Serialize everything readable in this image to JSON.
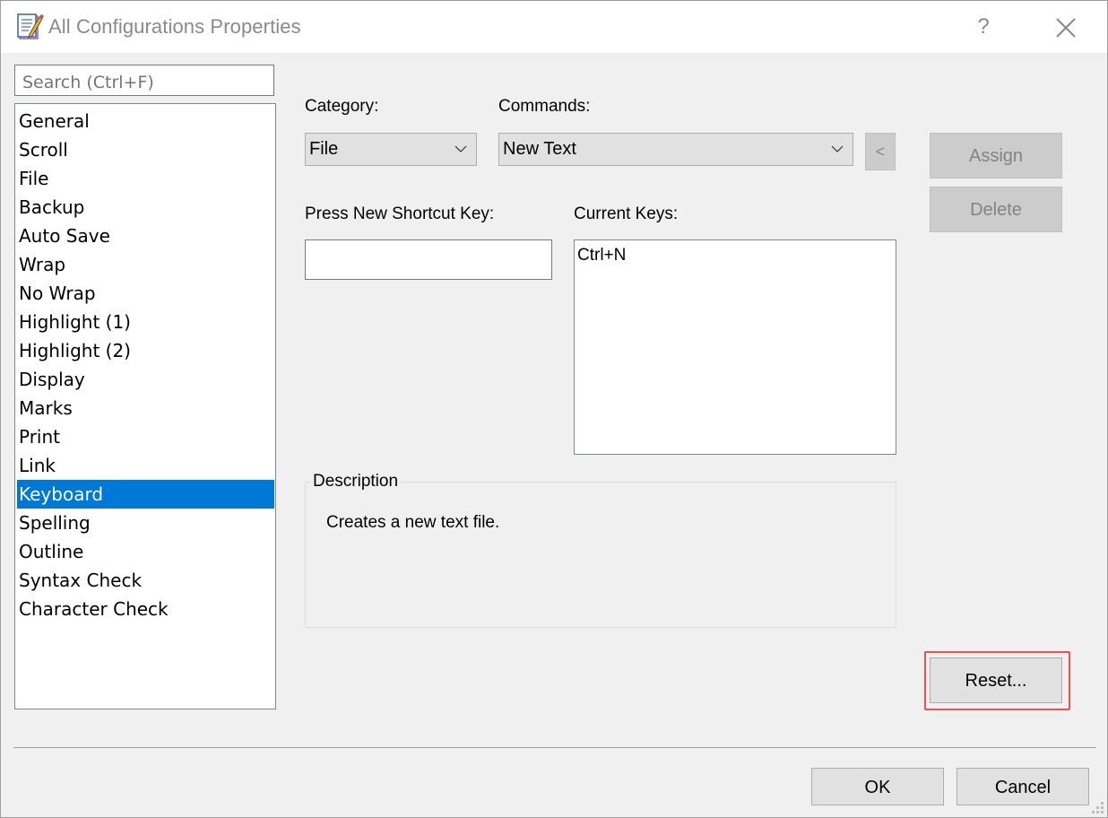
{
  "window": {
    "title": "All Configurations Properties",
    "help_label": "?",
    "icons": {
      "app": "notepad-pencil-icon",
      "help": "question-mark-icon",
      "close": "close-x-icon"
    }
  },
  "sidebar": {
    "search_placeholder": "Search (Ctrl+F)",
    "search_value": "",
    "selected": "Keyboard",
    "items": [
      {
        "label": "General"
      },
      {
        "label": "Scroll"
      },
      {
        "label": "File"
      },
      {
        "label": "Backup"
      },
      {
        "label": "Auto Save"
      },
      {
        "label": "Wrap"
      },
      {
        "label": "No Wrap"
      },
      {
        "label": "Highlight (1)"
      },
      {
        "label": "Highlight (2)"
      },
      {
        "label": "Display"
      },
      {
        "label": "Marks"
      },
      {
        "label": "Print"
      },
      {
        "label": "Link"
      },
      {
        "label": "Keyboard"
      },
      {
        "label": "Spelling"
      },
      {
        "label": "Outline"
      },
      {
        "label": "Syntax Check"
      },
      {
        "label": "Character Check"
      }
    ]
  },
  "keyboard": {
    "category_label": "Category:",
    "category_value": "File",
    "commands_label": "Commands:",
    "commands_value": "New Text",
    "prev_button_label": "<",
    "assign_label": "Assign",
    "delete_label": "Delete",
    "new_shortcut_label": "Press New Shortcut Key:",
    "new_shortcut_value": "",
    "current_keys_label": "Current Keys:",
    "current_keys": [
      "Ctrl+N"
    ],
    "description_title": "Description",
    "description_text": "Creates a new text file.",
    "reset_label": "Reset..."
  },
  "footer": {
    "ok_label": "OK",
    "cancel_label": "Cancel"
  },
  "colors": {
    "selection": "#0078d7",
    "highlight_border": "#f05050",
    "dialog_bg": "#f0f0f0"
  }
}
